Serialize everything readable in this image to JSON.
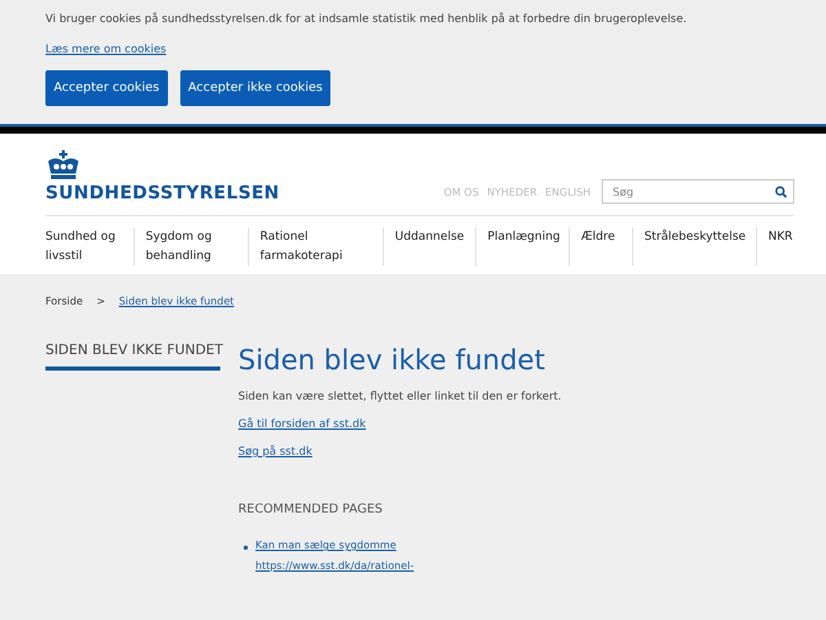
{
  "cookie_banner": {
    "message": "Vi bruger cookies på sundhedsstyrelsen.dk for at indsamle statistik med henblik på at forbedre din brugeroplevelse.",
    "link": "Læs mere om cookies",
    "buttons": [
      "Accepter cookies",
      "Accepter ikke cookies"
    ]
  },
  "header": {
    "logo_text": "SUNDHEDSSTYRELSEN",
    "top_links": [
      "OM OS",
      "NYHEDER",
      "ENGLISH"
    ],
    "search": {
      "placeholder": "Søg"
    }
  },
  "nav": [
    {
      "label": "Sundhed og livsstil"
    },
    {
      "label": "Sygdom og behandling"
    },
    {
      "label": "Rationel farmakoterapi"
    },
    {
      "label": "Uddannelse"
    },
    {
      "label": "Planlægning"
    },
    {
      "label": "Ældre"
    },
    {
      "label": "Strålebeskyttelse"
    },
    {
      "label": "NKR"
    }
  ],
  "breadcrumb": [
    {
      "label": "Forside",
      "selected": false
    },
    {
      "label": "Siden blev ikke fundet",
      "selected": true
    }
  ],
  "breadcrumb_separator": ">",
  "sidebar": {
    "title": "SIDEN BLEV IKKE FUNDET"
  },
  "main": {
    "title": "Siden blev ikke fundet",
    "text": "Siden kan være slettet, flyttet eller linket til den er forkert.",
    "links": [
      "Gå til forsiden af sst.dk",
      "Søg på sst.dk"
    ],
    "recommended_title": "RECOMMENDED PAGES",
    "recommended": [
      {
        "title": "Kan man sælge sygdomme",
        "url": "https://www.sst.dk/da/rationel-"
      }
    ]
  }
}
